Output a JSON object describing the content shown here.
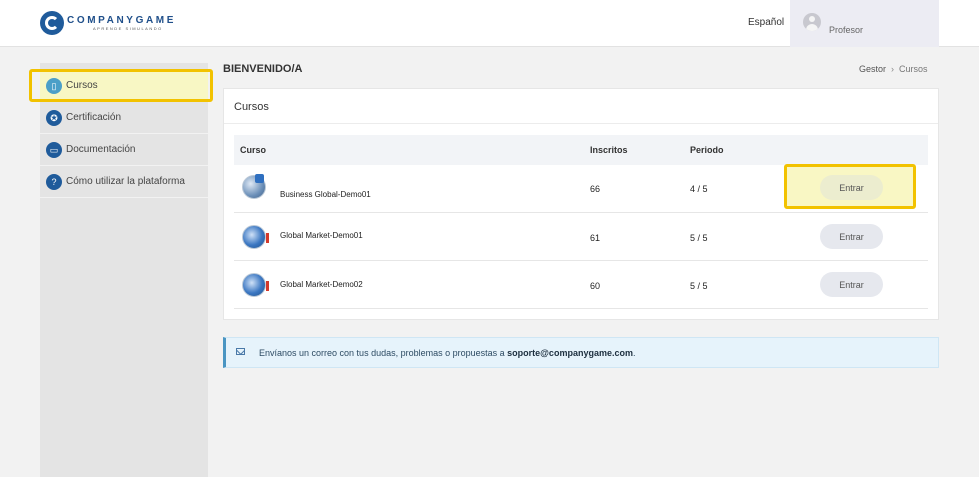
{
  "header": {
    "logo_name": "COMPANYGAME",
    "logo_tagline": "APRENDE SIMULANDO",
    "language": "Español",
    "user_name": "Profesor"
  },
  "sidebar": {
    "items": [
      {
        "label": "Cursos",
        "icon": "book-icon"
      },
      {
        "label": "Certificación",
        "icon": "award-icon"
      },
      {
        "label": "Documentación",
        "icon": "folder-icon"
      },
      {
        "label": "Cómo utilizar la plataforma",
        "icon": "help-icon"
      }
    ]
  },
  "main": {
    "welcome": "BIENVENIDO/A",
    "breadcrumb": {
      "root": "Gestor",
      "separator": "›",
      "current": "Cursos"
    },
    "card_title": "Cursos",
    "table": {
      "headers": {
        "course": "Curso",
        "enrolled": "Inscritos",
        "period": "Periodo"
      },
      "rows": [
        {
          "course": "Business Global-Demo01",
          "enrolled": "66",
          "period": "4 / 5",
          "action": "Entrar"
        },
        {
          "course": "Global Market-Demo01",
          "enrolled": "61",
          "period": "5 / 5",
          "action": "Entrar"
        },
        {
          "course": "Global Market-Demo02",
          "enrolled": "60",
          "period": "5 / 5",
          "action": "Entrar"
        }
      ]
    },
    "alert": {
      "text": "Envíanos un correo con tus dudas, problemas o propuestas a ",
      "email": "soporte@companygame.com",
      "end": "."
    }
  },
  "colors": {
    "brand": "#1f5b9b",
    "highlight": "#f2c200",
    "highlight_fill": "#f9f7c4"
  }
}
